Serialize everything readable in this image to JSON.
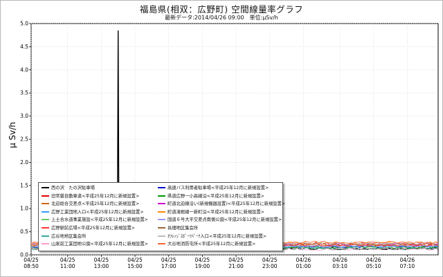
{
  "title": "福島県(相双：広野町) 空間線量率グラフ",
  "subtitle": "最新データ:2014/04/26 09:00　単位:μSv/h",
  "chart_data": {
    "type": "line",
    "ylabel": "μ Sv/h",
    "ylim": [
      0,
      5.0
    ],
    "yticks": [
      "0.0",
      "0.5",
      "1.0",
      "1.5",
      "2.0",
      "2.5",
      "3.0",
      "3.5",
      "4.0",
      "4.5",
      "5.0"
    ],
    "x_start": "2014-04-25T08:50",
    "x_end": "2014-04-26T09:00",
    "xticks": [
      {
        "date": "04/25",
        "time": "08:50"
      },
      {
        "date": "04/25",
        "time": "11:00"
      },
      {
        "date": "04/25",
        "time": "13:00"
      },
      {
        "date": "04/25",
        "time": "15:00"
      },
      {
        "date": "04/25",
        "time": "17:00"
      },
      {
        "date": "04/25",
        "time": "19:00"
      },
      {
        "date": "04/25",
        "time": "21:00"
      },
      {
        "date": "04/25",
        "time": "23:00"
      },
      {
        "date": "04/26",
        "time": "01:00"
      },
      {
        "date": "04/26",
        "time": "03:10"
      },
      {
        "date": "04/26",
        "time": "05:10"
      },
      {
        "date": "04/26",
        "time": "07:10"
      }
    ],
    "grid": true,
    "legend_position": "lower-left",
    "spike": {
      "series": "西の沢　たの沢駐車場",
      "time": "2014-04-25T14:00",
      "value": 4.85
    },
    "series": [
      {
        "name": "西の沢　たの沢駐車場",
        "color": "#000000",
        "level": 0.14
      },
      {
        "name": "高速バス利用者駐車場<平成25年12月に新規設置>",
        "color": "#0000cc",
        "level": 0.17
      },
      {
        "name": "旧常磐自動車道<平成25年12月に新規設置>",
        "color": "#dd0000",
        "level": 0.2
      },
      {
        "name": "県道広野一小高線沿<平成25年12月に新規設置>",
        "color": "#009900",
        "level": 0.16
      },
      {
        "name": "北迫総合交差点<平成25年12月に新規設置>",
        "color": "#cc6600",
        "level": 0.22
      },
      {
        "name": "町道北迫線沿い(新規機器設置)<平成25年12月に新規設置>",
        "color": "#cc00cc",
        "level": 0.24
      },
      {
        "name": "広野工業団地入口<平成25年12月に新規設置>",
        "color": "#3399ff",
        "level": 0.18
      },
      {
        "name": "町道滝根線一新町沿<平成25年12月に新規設置>",
        "color": "#ff8800",
        "level": 0.26
      },
      {
        "name": "上土合水道事業施設<平成25年12月に新規設置>",
        "color": "#66cc66",
        "level": 0.15
      },
      {
        "name": "国道６号大平交差点南側公園<平成25年12月に新規設置>",
        "color": "#9999ff",
        "level": 0.19
      },
      {
        "name": "広野駅前広場<平成25年12月に新規設置>",
        "color": "#ff3333",
        "level": 0.21
      },
      {
        "name": "長畑地区集会所",
        "color": "#996633",
        "level": 0.23
      },
      {
        "name": "広谷地地区集会所",
        "color": "#33aa99",
        "level": 0.13
      },
      {
        "name": "ｵﾌﾚｯｼﾞｽﾎﾟｰﾂﾊﾟｰｸ入口<平成25年12月に新規設置>",
        "color": "#bbbbbb",
        "level": 0.25
      },
      {
        "name": "山泉前工業団地公園<平成25年12月に新規設置>",
        "color": "#ff99cc",
        "level": 0.12
      },
      {
        "name": "大谷地消防屯所<平成25年12月に新規設置>",
        "color": "#ff6633",
        "level": 0.27
      }
    ]
  }
}
